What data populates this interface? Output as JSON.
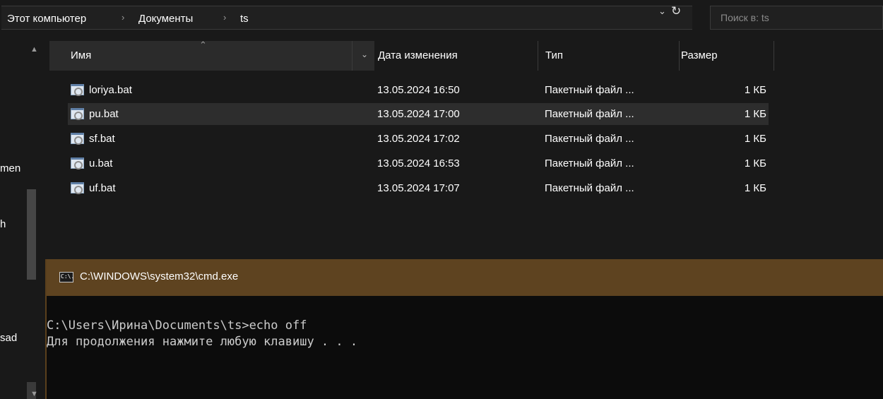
{
  "breadcrumb": {
    "items": [
      "Этот компьютер",
      "Документы",
      "ts"
    ],
    "separator": "›"
  },
  "address_controls": {
    "dropdown_icon": "chevron-down-icon",
    "refresh_icon": "refresh-icon"
  },
  "search": {
    "placeholder": "Поиск в: ts"
  },
  "nav": {
    "items": [
      "men",
      "h",
      "sad"
    ]
  },
  "columns": {
    "name": "Имя",
    "date": "Дата изменения",
    "type": "Тип",
    "size": "Размер"
  },
  "files": [
    {
      "name": "loriya.bat",
      "date": "13.05.2024 16:50",
      "type": "Пакетный файл ...",
      "size": "1 КБ"
    },
    {
      "name": "pu.bat",
      "date": "13.05.2024 17:00",
      "type": "Пакетный файл ...",
      "size": "1 КБ"
    },
    {
      "name": "sf.bat",
      "date": "13.05.2024 17:02",
      "type": "Пакетный файл ...",
      "size": "1 КБ"
    },
    {
      "name": "u.bat",
      "date": "13.05.2024 16:53",
      "type": "Пакетный файл ...",
      "size": "1 КБ"
    },
    {
      "name": "uf.bat",
      "date": "13.05.2024 17:07",
      "type": "Пакетный файл ...",
      "size": "1 КБ"
    }
  ],
  "cmd": {
    "icon_text": "C:\\.",
    "title": "C:\\WINDOWS\\system32\\cmd.exe",
    "lines": [
      "C:\\Users\\Ирина\\Documents\\ts>echo off",
      "Для продолжения нажмите любую клавишу . . ."
    ]
  },
  "colors": {
    "background": "#191919",
    "cmd_title_bar": "#5e4320",
    "cmd_background": "#0c0c0c",
    "selected_row": "#2d2d2d"
  }
}
